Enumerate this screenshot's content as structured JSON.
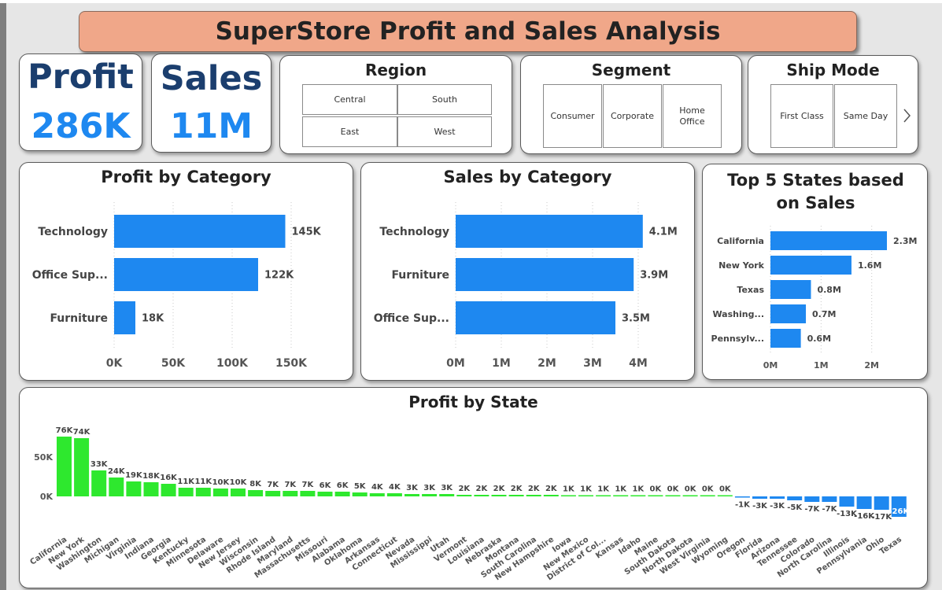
{
  "header": {
    "title": "SuperStore Profit and Sales Analysis"
  },
  "kpis": {
    "profit": {
      "label": "Profit",
      "value": "286K"
    },
    "sales": {
      "label": "Sales",
      "value": "11M"
    }
  },
  "slicers": {
    "region": {
      "title": "Region",
      "options": [
        "Central",
        "South",
        "East",
        "West"
      ]
    },
    "segment": {
      "title": "Segment",
      "options": [
        "Consumer",
        "Corporate",
        "Home Office"
      ]
    },
    "ship_mode": {
      "title": "Ship Mode",
      "options": [
        "First Class",
        "Same Day"
      ],
      "scroll_icon": "chevron-right-icon"
    }
  },
  "colors": {
    "bar_blue": "#1e88f0",
    "bar_green": "#2ee82e",
    "banner": "#f0a789",
    "kpi_title": "#1b3e6e"
  },
  "chart_data": [
    {
      "id": "profit_by_category",
      "type": "bar",
      "orientation": "horizontal",
      "title": "Profit by Category",
      "categories": [
        "Technology",
        "Office Sup...",
        "Furniture"
      ],
      "values": [
        145,
        122,
        18
      ],
      "data_labels": [
        "145K",
        "122K",
        "18K"
      ],
      "xticks": [
        0,
        50,
        100,
        150
      ],
      "xtick_labels": [
        "0K",
        "50K",
        "100K",
        "150K"
      ],
      "xlim": [
        0,
        150
      ]
    },
    {
      "id": "sales_by_category",
      "type": "bar",
      "orientation": "horizontal",
      "title": "Sales by Category",
      "categories": [
        "Technology",
        "Furniture",
        "Office Sup..."
      ],
      "values": [
        4.1,
        3.9,
        3.5
      ],
      "data_labels": [
        "4.1M",
        "3.9M",
        "3.5M"
      ],
      "xticks": [
        0,
        1,
        2,
        3,
        4
      ],
      "xtick_labels": [
        "0M",
        "1M",
        "2M",
        "3M",
        "4M"
      ],
      "xlim": [
        0,
        4
      ]
    },
    {
      "id": "top5_states_sales",
      "type": "bar",
      "orientation": "horizontal",
      "title": "Top 5 States based on Sales",
      "categories": [
        "California",
        "New York",
        "Texas",
        "Washing...",
        "Pennsylv..."
      ],
      "values": [
        2.3,
        1.6,
        0.8,
        0.7,
        0.6
      ],
      "data_labels": [
        "2.3M",
        "1.6M",
        "0.8M",
        "0.7M",
        "0.6M"
      ],
      "xticks": [
        0,
        1,
        2
      ],
      "xtick_labels": [
        "0M",
        "1M",
        "2M"
      ],
      "xlim": [
        0,
        2.3
      ]
    },
    {
      "id": "profit_by_state",
      "type": "bar",
      "title": "Profit by State",
      "categories": [
        "California",
        "New York",
        "Washington",
        "Michigan",
        "Virginia",
        "Indiana",
        "Georgia",
        "Kentucky",
        "Minnesota",
        "Delaware",
        "New Jersey",
        "Wisconsin",
        "Rhode Island",
        "Maryland",
        "Massachusetts",
        "Missouri",
        "Alabama",
        "Oklahoma",
        "Arkansas",
        "Connecticut",
        "Nevada",
        "Mississippi",
        "Utah",
        "Vermont",
        "Louisiana",
        "Nebraska",
        "Montana",
        "South Carolina",
        "New Hampshire",
        "Iowa",
        "New Mexico",
        "District of Col...",
        "Kansas",
        "Idaho",
        "Maine",
        "South Dakota",
        "North Dakota",
        "West Virginia",
        "Wyoming",
        "Oregon",
        "Florida",
        "Arizona",
        "Tennessee",
        "Colorado",
        "North Carolina",
        "Illinois",
        "Pennsylvania",
        "Ohio",
        "Texas"
      ],
      "values": [
        76,
        74,
        33,
        24,
        19,
        18,
        16,
        11,
        11,
        10,
        10,
        8,
        7,
        7,
        7,
        6,
        6,
        5,
        4,
        4,
        3,
        3,
        3,
        2,
        2,
        2,
        2,
        2,
        2,
        1,
        1,
        1,
        1,
        1,
        0,
        0,
        0,
        0,
        0,
        -1,
        -3,
        -3,
        -5,
        -7,
        -7,
        -13,
        -16,
        -17,
        -26
      ],
      "data_labels": [
        "76K",
        "74K",
        "33K",
        "24K",
        "19K",
        "18K",
        "16K",
        "11K",
        "11K",
        "10K",
        "10K",
        "8K",
        "7K",
        "7K",
        "7K",
        "6K",
        "6K",
        "5K",
        "4K",
        "4K",
        "3K",
        "3K",
        "3K",
        "2K",
        "2K",
        "2K",
        "2K",
        "2K",
        "2K",
        "1K",
        "1K",
        "1K",
        "1K",
        "1K",
        "0K",
        "0K",
        "0K",
        "0K",
        "0K",
        "-1K",
        "-3K",
        "-3K",
        "-5K",
        "-7K",
        "-7K",
        "-13K",
        "-16K",
        "-17K",
        "-26K"
      ],
      "yticks": [
        0,
        50
      ],
      "ytick_labels": [
        "0K",
        "50K"
      ]
    }
  ]
}
